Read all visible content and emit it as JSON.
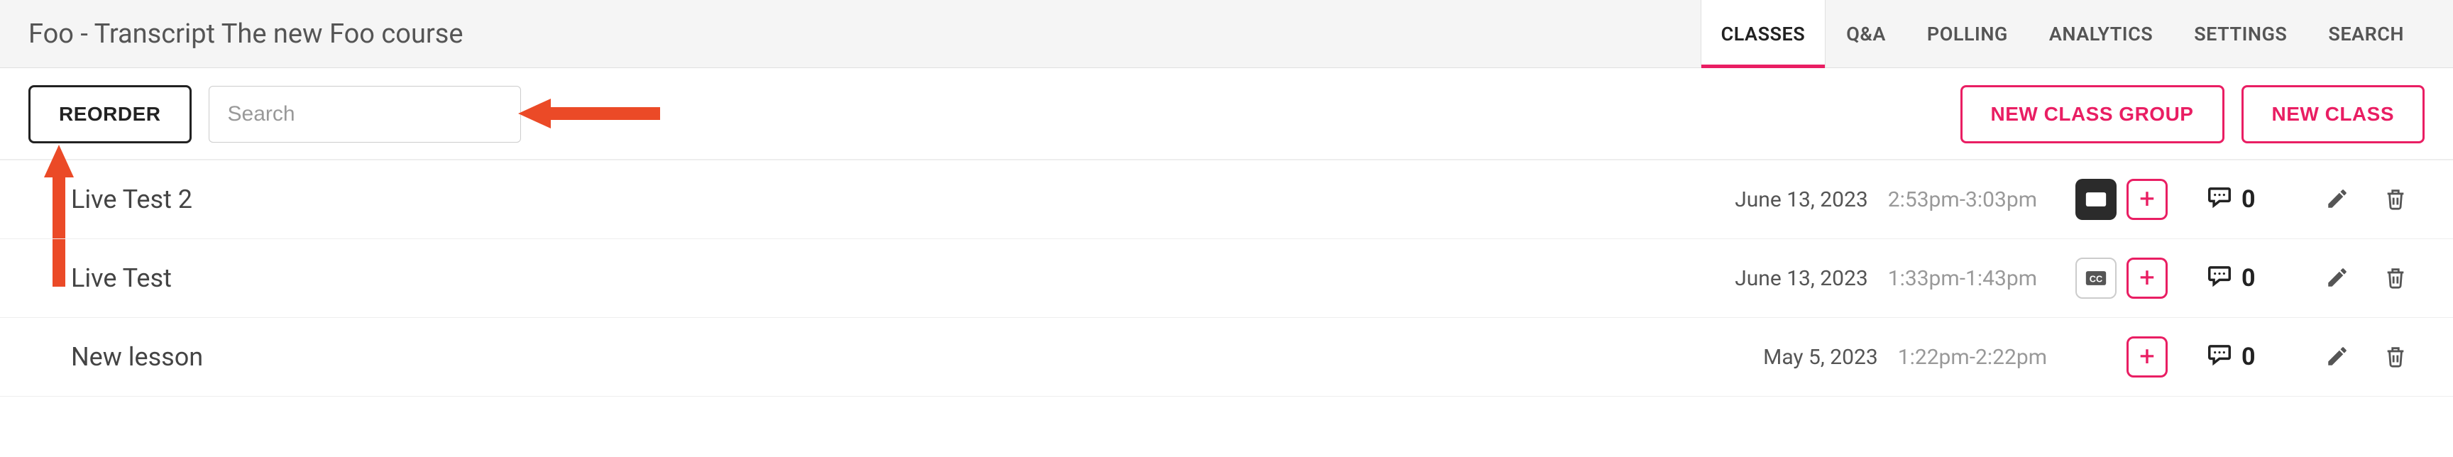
{
  "header": {
    "title": "Foo - Transcript The new Foo course",
    "tabs": {
      "classes": "CLASSES",
      "qa": "Q&A",
      "polling": "POLLING",
      "analytics": "ANALYTICS",
      "settings": "SETTINGS",
      "search": "SEARCH"
    },
    "active_tab": "classes"
  },
  "toolbar": {
    "reorder_label": "REORDER",
    "search_placeholder": "Search",
    "new_class_group_label": "NEW CLASS GROUP",
    "new_class_label": "NEW CLASS"
  },
  "rows": [
    {
      "title": "Live Test 2",
      "date": "June 13, 2023",
      "time": "2:53pm-3:03pm",
      "has_media": true,
      "comment_count": "0"
    },
    {
      "title": "Live Test",
      "date": "June 13, 2023",
      "time": "1:33pm-1:43pm",
      "has_media": true,
      "comment_count": "0"
    },
    {
      "title": "New lesson",
      "date": "May 5, 2023",
      "time": "1:22pm-2:22pm",
      "has_media": false,
      "comment_count": "0"
    }
  ],
  "annotations": {
    "arrow_to_search": true,
    "arrow_to_reorder": true,
    "arrow_color": "#eb4a27"
  }
}
